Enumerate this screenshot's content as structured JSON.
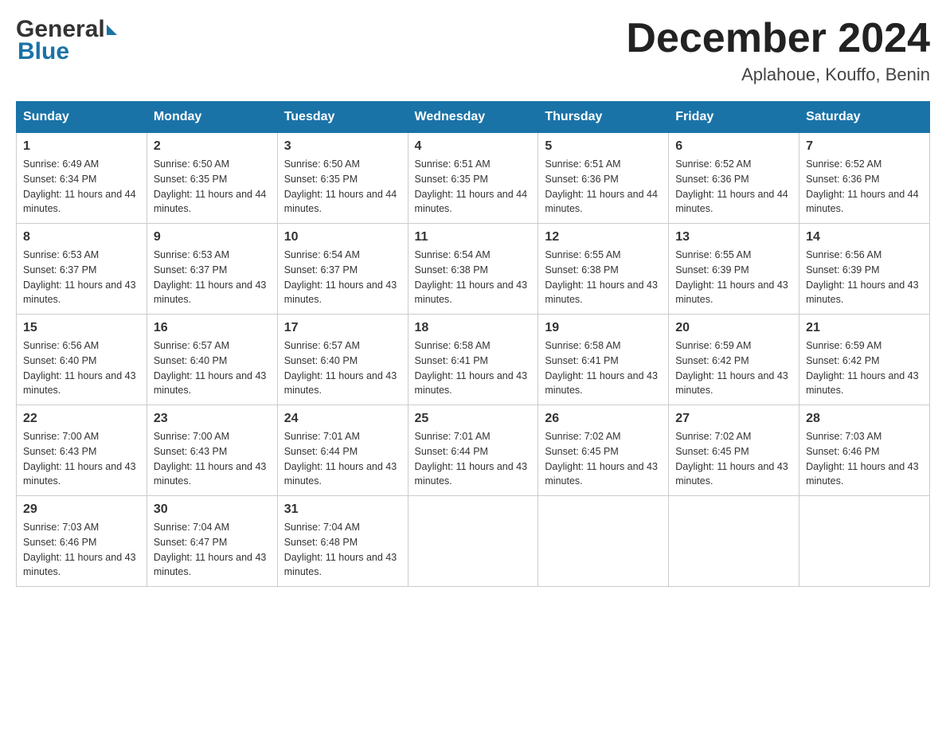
{
  "header": {
    "logo_general": "General",
    "logo_blue": "Blue",
    "month_title": "December 2024",
    "location": "Aplahoue, Kouffo, Benin"
  },
  "columns": [
    "Sunday",
    "Monday",
    "Tuesday",
    "Wednesday",
    "Thursday",
    "Friday",
    "Saturday"
  ],
  "weeks": [
    [
      {
        "day": "1",
        "sunrise": "Sunrise: 6:49 AM",
        "sunset": "Sunset: 6:34 PM",
        "daylight": "Daylight: 11 hours and 44 minutes."
      },
      {
        "day": "2",
        "sunrise": "Sunrise: 6:50 AM",
        "sunset": "Sunset: 6:35 PM",
        "daylight": "Daylight: 11 hours and 44 minutes."
      },
      {
        "day": "3",
        "sunrise": "Sunrise: 6:50 AM",
        "sunset": "Sunset: 6:35 PM",
        "daylight": "Daylight: 11 hours and 44 minutes."
      },
      {
        "day": "4",
        "sunrise": "Sunrise: 6:51 AM",
        "sunset": "Sunset: 6:35 PM",
        "daylight": "Daylight: 11 hours and 44 minutes."
      },
      {
        "day": "5",
        "sunrise": "Sunrise: 6:51 AM",
        "sunset": "Sunset: 6:36 PM",
        "daylight": "Daylight: 11 hours and 44 minutes."
      },
      {
        "day": "6",
        "sunrise": "Sunrise: 6:52 AM",
        "sunset": "Sunset: 6:36 PM",
        "daylight": "Daylight: 11 hours and 44 minutes."
      },
      {
        "day": "7",
        "sunrise": "Sunrise: 6:52 AM",
        "sunset": "Sunset: 6:36 PM",
        "daylight": "Daylight: 11 hours and 44 minutes."
      }
    ],
    [
      {
        "day": "8",
        "sunrise": "Sunrise: 6:53 AM",
        "sunset": "Sunset: 6:37 PM",
        "daylight": "Daylight: 11 hours and 43 minutes."
      },
      {
        "day": "9",
        "sunrise": "Sunrise: 6:53 AM",
        "sunset": "Sunset: 6:37 PM",
        "daylight": "Daylight: 11 hours and 43 minutes."
      },
      {
        "day": "10",
        "sunrise": "Sunrise: 6:54 AM",
        "sunset": "Sunset: 6:37 PM",
        "daylight": "Daylight: 11 hours and 43 minutes."
      },
      {
        "day": "11",
        "sunrise": "Sunrise: 6:54 AM",
        "sunset": "Sunset: 6:38 PM",
        "daylight": "Daylight: 11 hours and 43 minutes."
      },
      {
        "day": "12",
        "sunrise": "Sunrise: 6:55 AM",
        "sunset": "Sunset: 6:38 PM",
        "daylight": "Daylight: 11 hours and 43 minutes."
      },
      {
        "day": "13",
        "sunrise": "Sunrise: 6:55 AM",
        "sunset": "Sunset: 6:39 PM",
        "daylight": "Daylight: 11 hours and 43 minutes."
      },
      {
        "day": "14",
        "sunrise": "Sunrise: 6:56 AM",
        "sunset": "Sunset: 6:39 PM",
        "daylight": "Daylight: 11 hours and 43 minutes."
      }
    ],
    [
      {
        "day": "15",
        "sunrise": "Sunrise: 6:56 AM",
        "sunset": "Sunset: 6:40 PM",
        "daylight": "Daylight: 11 hours and 43 minutes."
      },
      {
        "day": "16",
        "sunrise": "Sunrise: 6:57 AM",
        "sunset": "Sunset: 6:40 PM",
        "daylight": "Daylight: 11 hours and 43 minutes."
      },
      {
        "day": "17",
        "sunrise": "Sunrise: 6:57 AM",
        "sunset": "Sunset: 6:40 PM",
        "daylight": "Daylight: 11 hours and 43 minutes."
      },
      {
        "day": "18",
        "sunrise": "Sunrise: 6:58 AM",
        "sunset": "Sunset: 6:41 PM",
        "daylight": "Daylight: 11 hours and 43 minutes."
      },
      {
        "day": "19",
        "sunrise": "Sunrise: 6:58 AM",
        "sunset": "Sunset: 6:41 PM",
        "daylight": "Daylight: 11 hours and 43 minutes."
      },
      {
        "day": "20",
        "sunrise": "Sunrise: 6:59 AM",
        "sunset": "Sunset: 6:42 PM",
        "daylight": "Daylight: 11 hours and 43 minutes."
      },
      {
        "day": "21",
        "sunrise": "Sunrise: 6:59 AM",
        "sunset": "Sunset: 6:42 PM",
        "daylight": "Daylight: 11 hours and 43 minutes."
      }
    ],
    [
      {
        "day": "22",
        "sunrise": "Sunrise: 7:00 AM",
        "sunset": "Sunset: 6:43 PM",
        "daylight": "Daylight: 11 hours and 43 minutes."
      },
      {
        "day": "23",
        "sunrise": "Sunrise: 7:00 AM",
        "sunset": "Sunset: 6:43 PM",
        "daylight": "Daylight: 11 hours and 43 minutes."
      },
      {
        "day": "24",
        "sunrise": "Sunrise: 7:01 AM",
        "sunset": "Sunset: 6:44 PM",
        "daylight": "Daylight: 11 hours and 43 minutes."
      },
      {
        "day": "25",
        "sunrise": "Sunrise: 7:01 AM",
        "sunset": "Sunset: 6:44 PM",
        "daylight": "Daylight: 11 hours and 43 minutes."
      },
      {
        "day": "26",
        "sunrise": "Sunrise: 7:02 AM",
        "sunset": "Sunset: 6:45 PM",
        "daylight": "Daylight: 11 hours and 43 minutes."
      },
      {
        "day": "27",
        "sunrise": "Sunrise: 7:02 AM",
        "sunset": "Sunset: 6:45 PM",
        "daylight": "Daylight: 11 hours and 43 minutes."
      },
      {
        "day": "28",
        "sunrise": "Sunrise: 7:03 AM",
        "sunset": "Sunset: 6:46 PM",
        "daylight": "Daylight: 11 hours and 43 minutes."
      }
    ],
    [
      {
        "day": "29",
        "sunrise": "Sunrise: 7:03 AM",
        "sunset": "Sunset: 6:46 PM",
        "daylight": "Daylight: 11 hours and 43 minutes."
      },
      {
        "day": "30",
        "sunrise": "Sunrise: 7:04 AM",
        "sunset": "Sunset: 6:47 PM",
        "daylight": "Daylight: 11 hours and 43 minutes."
      },
      {
        "day": "31",
        "sunrise": "Sunrise: 7:04 AM",
        "sunset": "Sunset: 6:48 PM",
        "daylight": "Daylight: 11 hours and 43 minutes."
      },
      {
        "day": "",
        "sunrise": "",
        "sunset": "",
        "daylight": ""
      },
      {
        "day": "",
        "sunrise": "",
        "sunset": "",
        "daylight": ""
      },
      {
        "day": "",
        "sunrise": "",
        "sunset": "",
        "daylight": ""
      },
      {
        "day": "",
        "sunrise": "",
        "sunset": "",
        "daylight": ""
      }
    ]
  ]
}
